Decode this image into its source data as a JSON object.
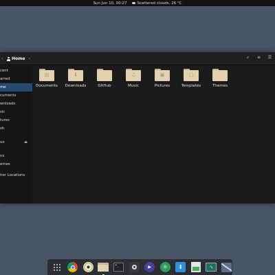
{
  "topbar": {
    "datetime": "Sun Jun 10, 00:27",
    "weather": "Scattered clouds, 26 °C"
  },
  "window": {
    "location": "Home",
    "header_icons": [
      "search-icon",
      "view-options-icon",
      "menu-icon"
    ]
  },
  "sidebar": {
    "items": [
      {
        "label": "cent",
        "active": false
      },
      {
        "label": "arred",
        "active": false
      },
      {
        "label": "me",
        "active": true
      },
      {
        "label": "cuments",
        "active": false
      },
      {
        "label": "wnloads",
        "active": false
      },
      {
        "label": "sic",
        "active": false
      },
      {
        "label": "tures",
        "active": false
      },
      {
        "label": "sh",
        "active": false
      }
    ],
    "devices": [
      {
        "label": "ux",
        "eject": true
      }
    ],
    "network": [
      {
        "label": "ns"
      },
      {
        "label": "emes"
      },
      {
        "label": "her Locations"
      }
    ]
  },
  "folders": [
    {
      "name": "Documents",
      "icon": "document-folder-icon"
    },
    {
      "name": "Downloads",
      "icon": "download-folder-icon"
    },
    {
      "name": "GitHub",
      "icon": "folder-icon"
    },
    {
      "name": "Music",
      "icon": "music-folder-icon"
    },
    {
      "name": "Pictures",
      "icon": "pictures-folder-icon"
    },
    {
      "name": "Templates",
      "icon": "templates-folder-icon"
    },
    {
      "name": "Themes",
      "icon": "folder-icon"
    }
  ],
  "dock": {
    "items": [
      {
        "name": "app-grid-icon",
        "running": false
      },
      {
        "name": "chrome-icon",
        "running": false
      },
      {
        "name": "disk-icon",
        "running": false
      },
      {
        "name": "files-icon",
        "running": true
      },
      {
        "name": "terminal-icon",
        "running": false
      },
      {
        "name": "screenshot-icon",
        "running": false
      },
      {
        "name": "media-player-icon",
        "running": false
      },
      {
        "name": "atom-icon",
        "running": false
      },
      {
        "name": "downloader-icon",
        "running": false
      },
      {
        "name": "image-viewer-icon",
        "running": false
      },
      {
        "name": "system-monitor-icon",
        "running": false
      },
      {
        "name": "network-icon",
        "running": false
      }
    ]
  },
  "colors": {
    "desktop": "#4a5565",
    "accent": "#274a73",
    "folder": "#e3d2b1"
  }
}
